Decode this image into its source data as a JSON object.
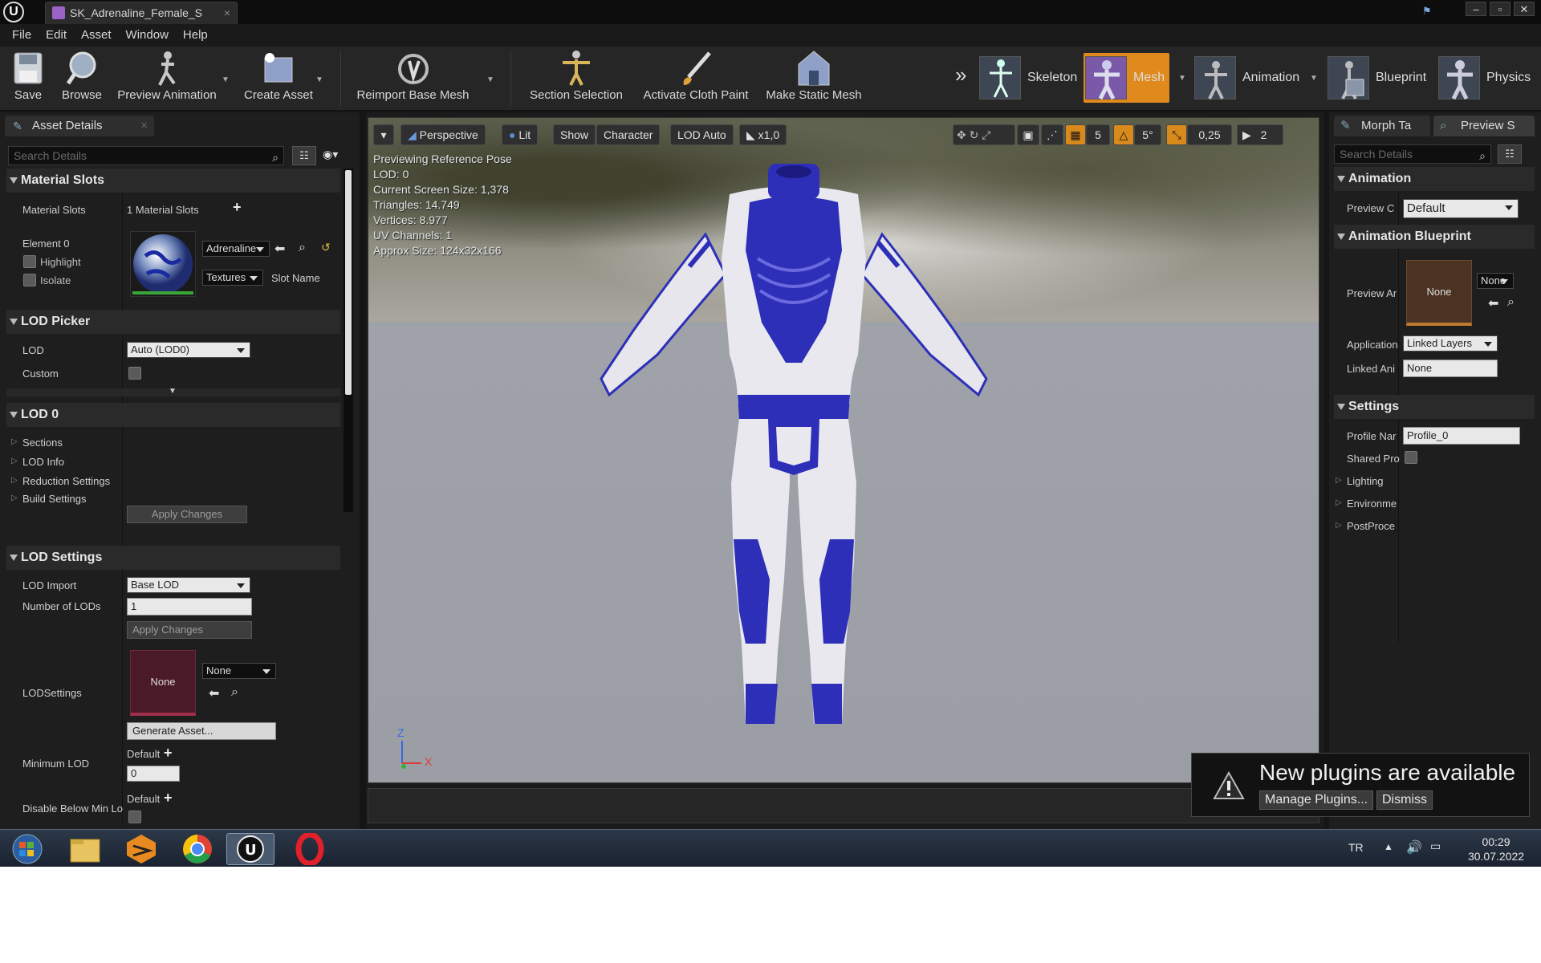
{
  "window": {
    "tab_title": "SK_Adrenaline_Female_S",
    "tab_close": "×",
    "controls": [
      "–",
      "▫",
      "✕"
    ]
  },
  "menu": [
    "File",
    "Edit",
    "Asset",
    "Window",
    "Help"
  ],
  "toolbar": {
    "save": "Save",
    "browse": "Browse",
    "preview_animation": "Preview Animation",
    "create_asset": "Create Asset",
    "reimport_base_mesh": "Reimport Base Mesh",
    "section_selection": "Section Selection",
    "activate_cloth_paint": "Activate Cloth Paint",
    "make_static_mesh": "Make Static Mesh",
    "overflow": "»",
    "modes": {
      "skeleton": "Skeleton",
      "mesh": "Mesh",
      "animation": "Animation",
      "blueprint": "Blueprint",
      "physics": "Physics"
    }
  },
  "left_panel": {
    "tab": "Asset Details",
    "search_placeholder": "Search Details",
    "material_slots": {
      "header": "Material Slots",
      "label": "Material Slots",
      "value": "1 Material Slots",
      "element": "Element 0",
      "highlight": "Highlight",
      "isolate": "Isolate",
      "material_combo": "Adrenaline",
      "textures_combo": "Textures",
      "slot_name": "Slot Name"
    },
    "lod_picker": {
      "header": "LOD Picker",
      "lod_label": "LOD",
      "lod_value": "Auto (LOD0)",
      "custom_label": "Custom"
    },
    "lod0": {
      "header": "LOD 0",
      "items": [
        "Sections",
        "LOD Info",
        "Reduction Settings",
        "Build Settings"
      ],
      "apply": "Apply Changes"
    },
    "lod_settings": {
      "header": "LOD Settings",
      "lod_import_label": "LOD Import",
      "lod_import_value": "Base LOD",
      "num_lods_label": "Number of LODs",
      "num_lods_value": "1",
      "apply": "Apply Changes",
      "lodsettings_label": "LODSettings",
      "thumb_none": "None",
      "asset_combo": "None",
      "generate": "Generate Asset...",
      "min_lod_label": "Minimum LOD",
      "min_lod_default": "Default",
      "min_lod_value": "0",
      "disable_label": "Disable Below Min Lo",
      "disable_default": "Default"
    }
  },
  "viewport": {
    "perspective": "Perspective",
    "lit": "Lit",
    "show": "Show",
    "character": "Character",
    "lod_auto": "LOD Auto",
    "speed": "x1,0",
    "grid_size": "5",
    "angle": "5°",
    "scale": "0,25",
    "camera_speed": "2",
    "stats": [
      "Previewing Reference Pose",
      "LOD: 0",
      "Current Screen Size: 1,378",
      "Triangles: 14.749",
      "Vertices: 8.977",
      "UV Channels: 1",
      "Approx Size: 124x32x166"
    ],
    "axis_z": "Z",
    "axis_x": "X"
  },
  "right_panel": {
    "tab_morph": "Morph Ta",
    "tab_preview": "Preview S",
    "search_placeholder": "Search Details",
    "animation": {
      "header": "Animation",
      "preview_controller_label": "Preview C",
      "preview_controller_value": "Default"
    },
    "animation_blueprint": {
      "header": "Animation Blueprint",
      "preview_anim_label": "Preview Ar",
      "thumb_none": "None",
      "combo_none": "None",
      "application_label": "Application",
      "application_value": "Linked Layers",
      "linked_anim_label": "Linked Ani",
      "linked_anim_value": "None"
    },
    "settings": {
      "header": "Settings",
      "profile_label": "Profile Nar",
      "profile_value": "Profile_0",
      "shared_label": "Shared Pro",
      "items": [
        "Lighting",
        "Environme",
        "PostProce"
      ]
    }
  },
  "notification": {
    "title": "New plugins are available",
    "manage": "Manage Plugins...",
    "dismiss": "Dismiss"
  },
  "taskbar": {
    "language": "TR",
    "time": "00:29",
    "date": "30.07.2022"
  },
  "colors": {
    "accent_orange": "#e08a1e",
    "suit_blue": "#2d2fb8",
    "suit_white": "#e8e8ee"
  }
}
